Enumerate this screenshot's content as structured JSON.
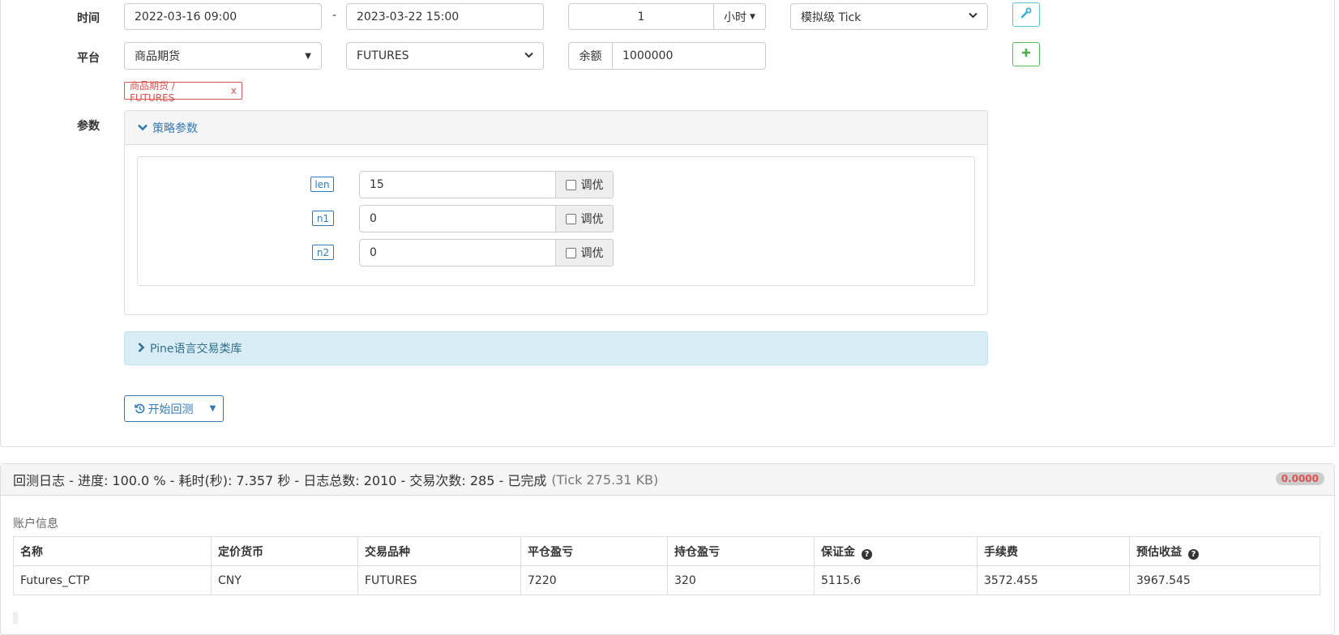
{
  "form": {
    "time_label": "时间",
    "start_time": "2022-03-16 09:00",
    "dash": "-",
    "end_time": "2023-03-22 15:00",
    "period_value": "1",
    "period_unit": "小时",
    "tick_mode": "模拟级 Tick",
    "platform_label": "平台",
    "platform": "商品期货",
    "symbol": "FUTURES",
    "balance_label": "余额",
    "balance": "1000000",
    "selected_tag": "商品期货 / FUTURES",
    "tag_remove": "x",
    "params_label": "参数"
  },
  "strategy_params": {
    "title": "策略参数",
    "items": [
      {
        "name": "len",
        "value": "15",
        "optimize_label": "调优"
      },
      {
        "name": "n1",
        "value": "0",
        "optimize_label": "调优"
      },
      {
        "name": "n2",
        "value": "0",
        "optimize_label": "调优"
      }
    ]
  },
  "pine_library": {
    "title": "Pine语言交易类库"
  },
  "actions": {
    "start_backtest": "开始回测"
  },
  "log": {
    "title": "回测日志 - 进度: 100.0 % - 耗时(秒): 7.357 秒 - 日志总数: 2010 - 交易次数: 285 - 已完成",
    "size": "(Tick 275.31 KB)",
    "badge": "0.0000"
  },
  "account": {
    "title": "账户信息",
    "headers": [
      "名称",
      "定价货币",
      "交易品种",
      "平仓盈亏",
      "持仓盈亏",
      "保证金",
      "手续费",
      "预估收益"
    ],
    "rows": [
      [
        "Futures_CTP",
        "CNY",
        "FUTURES",
        "7220",
        "320",
        "5115.6",
        "3572.455",
        "3967.545"
      ]
    ]
  },
  "icons": {
    "wrench": "wrench-icon",
    "plus": "plus-icon",
    "history": "history-icon",
    "question": "question-circle-icon"
  },
  "colors": {
    "primary": "#337ab7",
    "info": "#5bc0de",
    "success": "#5cb85c",
    "danger": "#d9534f",
    "info_bg": "#d9edf7"
  }
}
